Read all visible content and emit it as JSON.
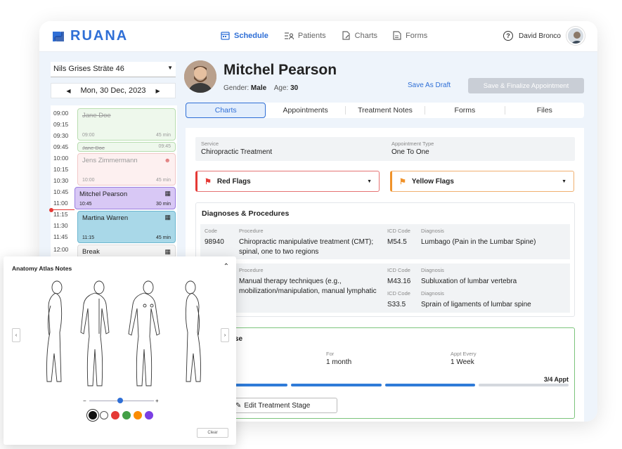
{
  "brand": {
    "name": "RUANA",
    "color": "#2f6fd6"
  },
  "nav": [
    {
      "label": "Schedule",
      "icon": "calendar-icon",
      "active": true
    },
    {
      "label": "Patients",
      "icon": "patients-icon",
      "active": false
    },
    {
      "label": "Charts",
      "icon": "charts-icon",
      "active": false
    },
    {
      "label": "Forms",
      "icon": "forms-icon",
      "active": false
    }
  ],
  "user": {
    "name": "David Bronco"
  },
  "location": {
    "value": "Nils Grises Sträte 46"
  },
  "date": {
    "value": "Mon, 30 Dec, 2023"
  },
  "schedule": {
    "slots": [
      "09:00",
      "09:15",
      "09:30",
      "09:45",
      "10:00",
      "10:15",
      "10:30",
      "10:45",
      "11:00",
      "11:15",
      "11:30",
      "11:45",
      "12:00"
    ],
    "appointments": [
      {
        "name": "Jane Doe",
        "start": "09:00",
        "duration": "45 min"
      },
      {
        "name": "Jane Doe",
        "start": "09:45"
      },
      {
        "name": "Jens Zimmermann",
        "start": "10:00",
        "duration": "45 min"
      },
      {
        "name": "Mitchel Pearson",
        "start": "10:45",
        "duration": "30 min"
      },
      {
        "name": "Martina Warren",
        "start": "11:15",
        "duration": "45 min"
      },
      {
        "name": "Break"
      }
    ]
  },
  "patient": {
    "name": "Mitchel Pearson",
    "gender_label": "Gender:",
    "gender": "Male",
    "age_label": "Age:",
    "age": "30"
  },
  "actions": {
    "save_draft": "Save As Draft",
    "finalize": "Save & Finalize Appointment"
  },
  "tabs": [
    "Charts",
    "Appointments",
    "Treatment Notes",
    "Forms",
    "Files"
  ],
  "service": {
    "service_label": "Service",
    "service_value": "Chiropractic Treatment",
    "type_label": "Appointment Type",
    "type_value": "One To One"
  },
  "flags": {
    "red": "Red Flags",
    "yellow": "Yellow Flags"
  },
  "diagnoses": {
    "title": "Diagnoses & Procedures",
    "code_label": "Code",
    "procedure_label": "Procedure",
    "icd_label": "ICD Code",
    "diagnosis_label": "Diagnosis",
    "rows": [
      {
        "code": "98940",
        "procedure_l1": "Chiropractic manipulative treatment (CMT);",
        "procedure_l2": "spinal, one to two regions",
        "icd": "M54.5",
        "diagnosis": "Lumbago (Pain in the Lumbar Spine)"
      },
      {
        "procedure_l1": "Manual therapy techniques (e.g.,",
        "procedure_l2": "mobilization/manipulation, manual lymphatic",
        "icd": "M43.16",
        "diagnosis": "Subluxation of lumbar vertebra",
        "icd2": "S33.5",
        "diagnosis2": "Sprain of ligaments of lumbar spine"
      }
    ]
  },
  "treatment": {
    "title_fragment": "se",
    "for_label": "For",
    "for_value": "1 month",
    "every_label": "Appt Every",
    "every_value": "1 Week",
    "progress": "3/4 Appt",
    "completed": 3,
    "total": 4,
    "edit_button": "Edit Treatment Stage"
  },
  "atlas": {
    "title": "Anatomy Atlas Notes",
    "slider_minus": "−",
    "slider_plus": "+",
    "colors": [
      "#111111",
      "#ffffff",
      "#e53935",
      "#43a047",
      "#fb8c00",
      "#7b3fe4"
    ],
    "clear": "Clear"
  }
}
